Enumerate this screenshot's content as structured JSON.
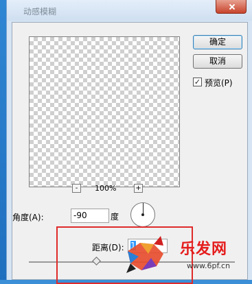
{
  "window": {
    "title": "动感模糊"
  },
  "buttons": {
    "ok": "确定",
    "cancel": "取消"
  },
  "preview_toggle": {
    "label": "预览(P)",
    "checked": true,
    "check_glyph": "✓"
  },
  "zoom": {
    "out_glyph": "-",
    "in_glyph": "+",
    "value": "100%"
  },
  "angle": {
    "label": "角度(A):",
    "value": "-90",
    "unit": "度"
  },
  "distance": {
    "label": "距离(D):",
    "value": "1"
  },
  "watermark": {
    "brand": "乐发网",
    "url": "www.6pf.cn"
  },
  "colors": {
    "highlight": "#e02a2a",
    "title_bg": "#d6e4f3",
    "selection": "#3399ff"
  }
}
